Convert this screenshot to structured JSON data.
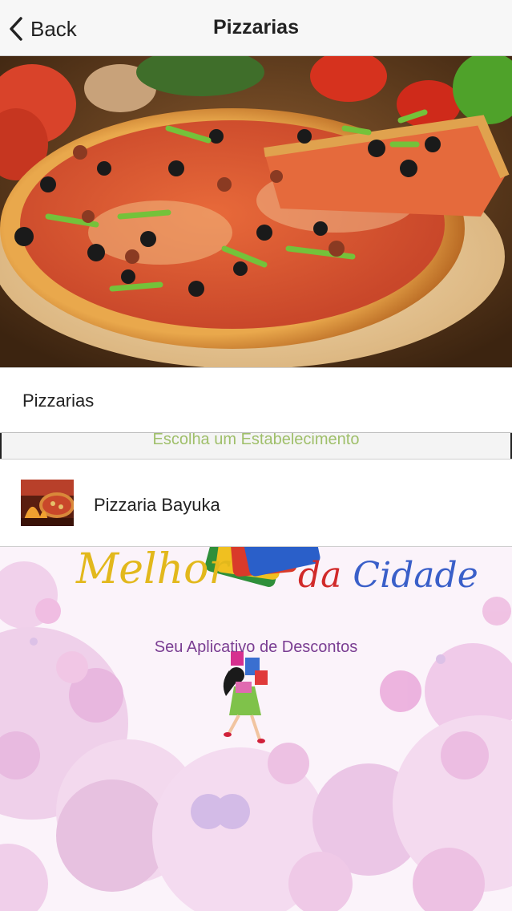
{
  "navbar": {
    "back_label": "Back",
    "title": "Pizzarias"
  },
  "section": {
    "label": "Pizzarias"
  },
  "prompt": {
    "text": "Escolha um Estabelecimento"
  },
  "establishments": [
    {
      "name": "Pizzaria Bayuka"
    }
  ],
  "promo": {
    "title_part1": "Melhor",
    "title_part2_a": "da",
    "title_part2_b": "Cidade",
    "subtitle": "Seu Aplicativo de Descontos"
  },
  "colors": {
    "accent_green": "#9fbf6a",
    "promo_purple": "#7a3d92"
  }
}
